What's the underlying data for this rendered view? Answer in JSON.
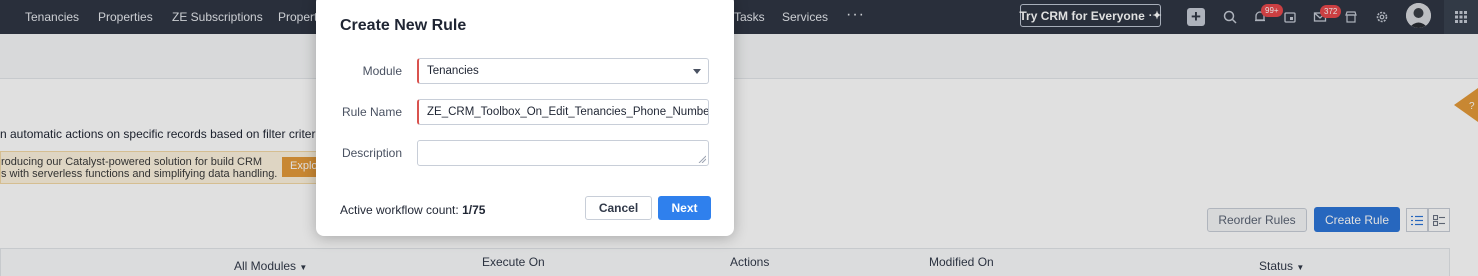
{
  "topnav": {
    "items": [
      "Tenancies",
      "Properties",
      "ZE Subscriptions",
      "Property",
      "Tasks",
      "Services"
    ],
    "more_label": "···",
    "try_button": "Try CRM for Everyone",
    "notifications_badge": "99+",
    "mail_badge": "372",
    "icons": [
      "plus-icon",
      "search-icon",
      "bell-icon",
      "calendar-icon",
      "mail-icon",
      "marketplace-icon",
      "gear-icon",
      "avatar",
      "app-grid-icon"
    ]
  },
  "background_page": {
    "description": "n automatic actions on specific records based on filter criteria. Wo",
    "promo_line1": "roducing our Catalyst-powered solution for build CRM",
    "promo_line2": "s with serverless functions and simplifying data handling.",
    "promo_button": "Explo",
    "reorder_button": "Reorder Rules",
    "create_rule_button": "Create Rule",
    "table_headers": {
      "modules": "All Modules",
      "execute_on": "Execute On",
      "actions": "Actions",
      "modified_on": "Modified On",
      "status": "Status"
    }
  },
  "modal": {
    "title": "Create New Rule",
    "module_label": "Module",
    "module_value": "Tenancies",
    "rule_name_label": "Rule Name",
    "rule_name_value": "ZE_CRM_Toolbox_On_Edit_Tenancies_Phone_Number",
    "description_label": "Description",
    "description_value": "",
    "count_label": "Active workflow count:",
    "count_value": "1/75",
    "cancel_button": "Cancel",
    "next_button": "Next"
  },
  "colors": {
    "nav_bg": "#2f3644",
    "primary": "#2f80ed",
    "required_marker": "#d9534f",
    "badge": "#e8484c",
    "promo_bg": "#fdf3df",
    "help_tab": "#e49a3a"
  }
}
